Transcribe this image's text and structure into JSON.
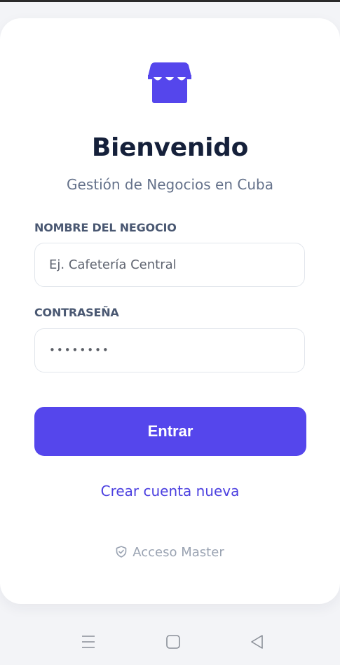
{
  "app": {
    "title": "Bienvenido",
    "subtitle": "Gestión de Negocios en Cuba",
    "logo_icon": "store-icon",
    "brand_color": "#5546ec"
  },
  "form": {
    "business_name_label": "NOMBRE DEL NEGOCIO",
    "business_name_placeholder": "Ej. Cafetería Central",
    "business_name_value": "",
    "password_label": "CONTRASEÑA",
    "password_value": "••••••••",
    "submit_label": "Entrar"
  },
  "links": {
    "create_account": "Crear cuenta nueva",
    "master_access": "Acceso Master",
    "master_icon": "shield-check-icon"
  },
  "navbar": {
    "icons": [
      "menu-icon",
      "home-square-icon",
      "back-triangle-icon"
    ]
  }
}
